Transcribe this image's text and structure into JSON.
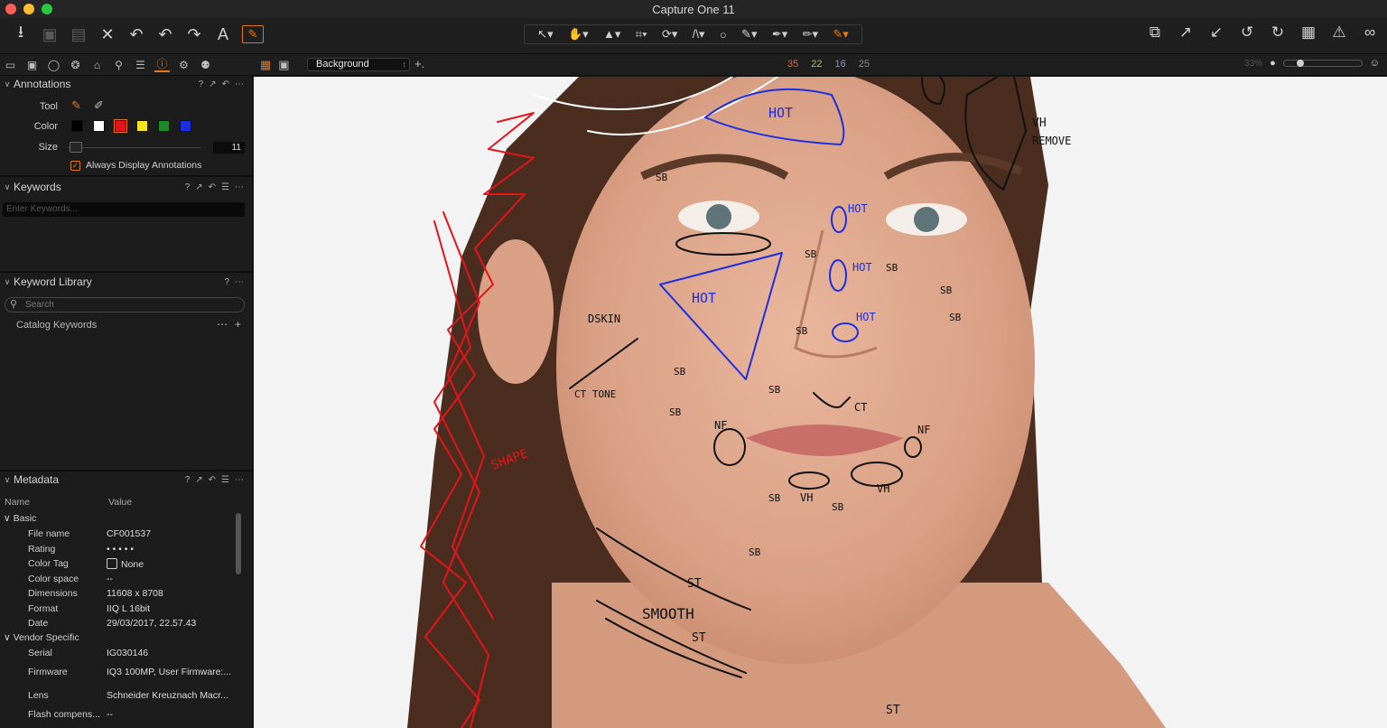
{
  "window": {
    "title": "Capture One 11"
  },
  "toolbar": {
    "left_icons": [
      "import-icon",
      "camera-icon",
      "export-icon",
      "close-icon",
      "undo-icon",
      "undo-step-icon",
      "redo-step-icon",
      "text-icon",
      "annotate-icon"
    ],
    "tools": [
      "cursor-tool-icon",
      "hand-tool-icon",
      "stack-tool-icon",
      "crop-tool-icon",
      "rotate-tool-icon",
      "keystone-tool-icon",
      "circle-tool-icon",
      "brush-tool-icon",
      "picker-tool-icon",
      "eraser-tool-icon",
      "pen-tool-icon"
    ],
    "right_icons": [
      "stack-icon",
      "move-up-icon",
      "move-down-icon",
      "rotate-left-icon",
      "rotate-right-icon",
      "grid-icon",
      "warning-icon",
      "glasses-icon"
    ]
  },
  "subbar": {
    "background_select": "Background",
    "counts": [
      {
        "value": "35",
        "color": "#e0603a"
      },
      {
        "value": "22",
        "color": "#8fcf52"
      },
      {
        "value": "16",
        "color": "#7b8fe8"
      },
      {
        "value": "25",
        "color": "#8a8a8a"
      }
    ],
    "zoom": "33%"
  },
  "annotations": {
    "title": "Annotations",
    "tool_label": "Tool",
    "color_label": "Color",
    "size_label": "Size",
    "size_value": "11",
    "colors": [
      "#000000",
      "#ffffff",
      "#e3141b",
      "#f4e61c",
      "#1f8a2c",
      "#1c2ee0"
    ],
    "selected_color": "#e3141b",
    "always_display": "Always Display Annotations"
  },
  "keywords": {
    "title": "Keywords",
    "placeholder": "Enter Keywords..."
  },
  "keyword_library": {
    "title": "Keyword Library",
    "search_placeholder": "Search",
    "catalog": "Catalog Keywords"
  },
  "metadata": {
    "title": "Metadata",
    "col_name": "Name",
    "col_value": "Value",
    "basic_label": "Basic",
    "basic": [
      {
        "key": "File name",
        "value": "CF001537"
      },
      {
        "key": "Rating",
        "value": "• • • • •"
      },
      {
        "key": "Color Tag",
        "value": "None"
      },
      {
        "key": "Color space",
        "value": "--"
      },
      {
        "key": "Dimensions",
        "value": "11608 x 8708"
      },
      {
        "key": "Format",
        "value": "IIQ L 16bit"
      },
      {
        "key": "Date",
        "value": "29/03/2017, 22.57.43"
      }
    ],
    "vendor_label": "Vendor Specific",
    "vendor": [
      {
        "key": "Serial",
        "value": "IG030146"
      },
      {
        "key": "Firmware",
        "value": "IQ3 100MP, User Firmware:..."
      },
      {
        "key": "Lens",
        "value": "Schneider Kreuznach Macr..."
      },
      {
        "key": "Flash compens...",
        "value": "--"
      }
    ]
  },
  "annotation_labels": {
    "hot": "HOT",
    "vh_remove": "VH",
    "remove": "REMOVE",
    "dskin": "DSKIN",
    "sb": "SB",
    "nf": "NF",
    "ct": "CT",
    "st": "ST",
    "smooth": "SMOOTH",
    "shape": "SHAPE",
    "vh": "VH",
    "ctone": "CT TONE"
  }
}
